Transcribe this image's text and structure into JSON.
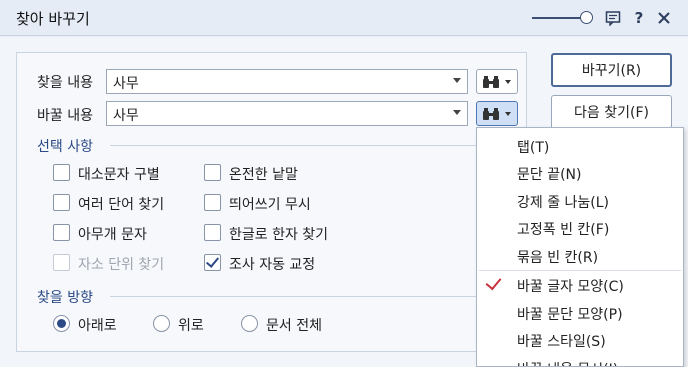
{
  "window": {
    "title": "찾아 바꾸기",
    "icons": [
      "slider-icon",
      "comment-icon",
      "help-icon",
      "close-icon"
    ]
  },
  "find": {
    "label": "찾을 내용",
    "value": "사무"
  },
  "replace": {
    "label": "바꿀 내용",
    "value": "사무"
  },
  "options": {
    "title": "선택 사항",
    "items": [
      {
        "label": "대소문자 구별",
        "checked": false,
        "disabled": false
      },
      {
        "label": "온전한 낱말",
        "checked": false,
        "disabled": false
      },
      {
        "label": "여러 단어 찾기",
        "checked": false,
        "disabled": false
      },
      {
        "label": "띄어쓰기 무시",
        "checked": false,
        "disabled": false
      },
      {
        "label": "아무개 문자",
        "checked": false,
        "disabled": false
      },
      {
        "label": "한글로 한자 찾기",
        "checked": false,
        "disabled": false
      },
      {
        "label": "자소 단위 찾기",
        "checked": false,
        "disabled": true
      },
      {
        "label": "조사 자동 교정",
        "checked": true,
        "disabled": false
      }
    ]
  },
  "direction": {
    "title": "찾을 방향",
    "items": [
      {
        "label": "아래로",
        "checked": true
      },
      {
        "label": "위로",
        "checked": false
      },
      {
        "label": "문서 전체",
        "checked": false
      }
    ]
  },
  "buttons": {
    "replace": "바꾸기(R)",
    "find_next": "다음 찾기(F)"
  },
  "menu": {
    "items": [
      {
        "label": "탭(T)"
      },
      {
        "label": "문단 끝(N)"
      },
      {
        "label": "강제 줄 나눔(L)"
      },
      {
        "label": "고정폭 빈 칸(F)"
      },
      {
        "label": "묶음 빈 칸(R)"
      },
      {
        "label": "바꿀 글자 모양(C)",
        "checked": true
      },
      {
        "label": "바꿀 문단 모양(P)"
      },
      {
        "label": "바꿀 스타일(S)"
      },
      {
        "label": "바꿀 내용 무시(I)"
      }
    ]
  }
}
